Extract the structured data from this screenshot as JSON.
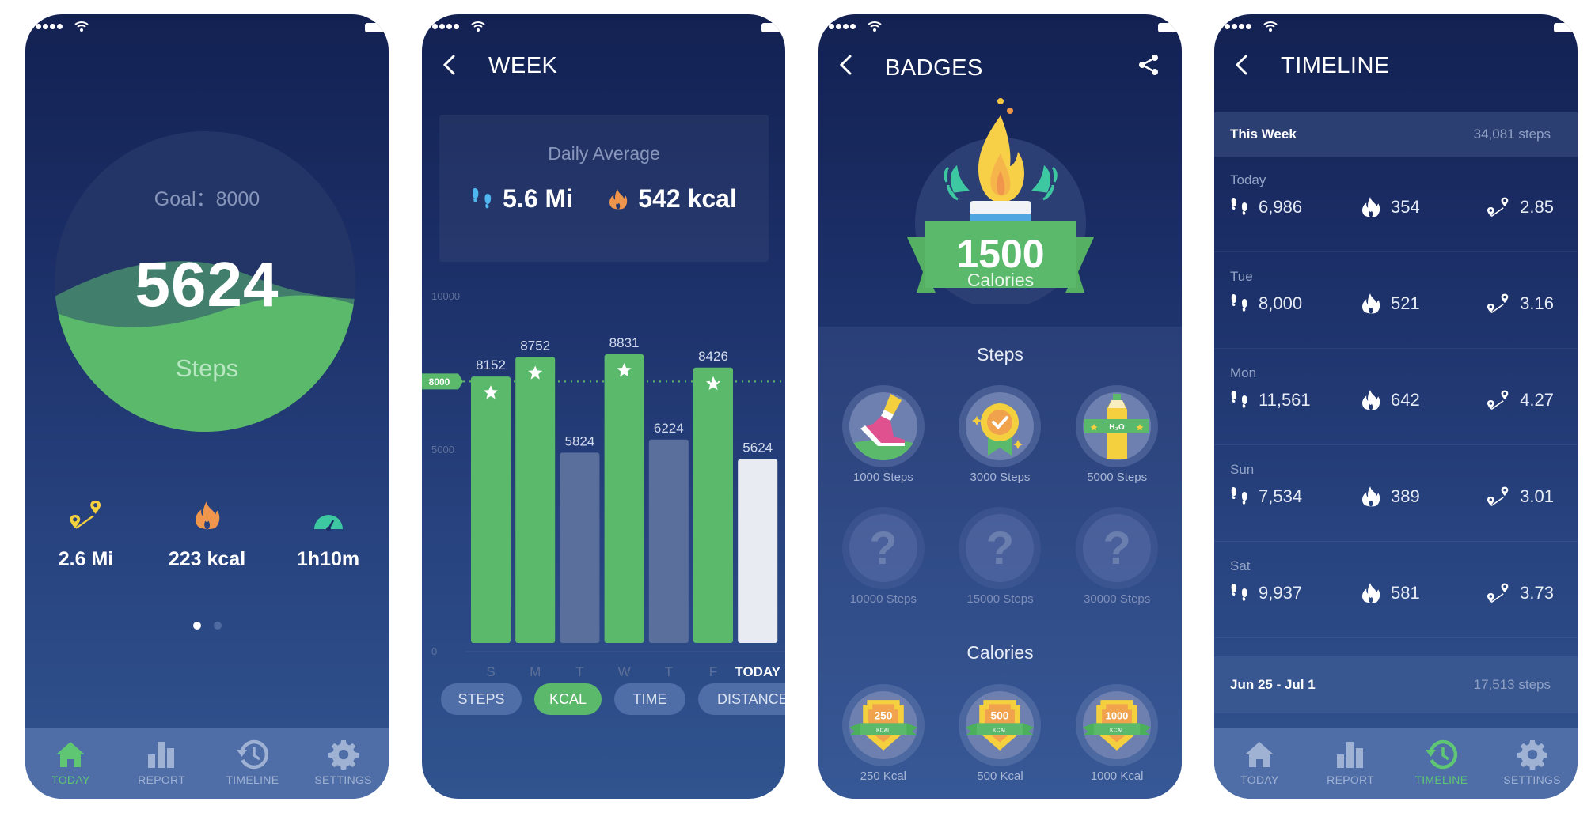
{
  "colors": {
    "green": "#5bb96b",
    "active_tab": "#5fc774",
    "bg_top": "#132152",
    "bg_bottom": "#30548f",
    "tabbar": "#4f6da6",
    "yellow": "#f4d03f",
    "orange": "#f0964c",
    "teal": "#3ec8a2"
  },
  "tabbar": {
    "items": [
      {
        "label": "TODAY",
        "icon": "home-icon"
      },
      {
        "label": "REPORT",
        "icon": "bar-chart-icon"
      },
      {
        "label": "TIMELINE",
        "icon": "history-icon"
      },
      {
        "label": "SETTINGS",
        "icon": "gear-icon"
      }
    ]
  },
  "today": {
    "goal_label": "Goal：8000",
    "steps": "5624",
    "steps_label": "Steps",
    "progress_fraction": 0.703,
    "stats": [
      {
        "icon": "route-pin-icon",
        "value": "2.6 Mi"
      },
      {
        "icon": "flame-icon",
        "value": "223 kcal"
      },
      {
        "icon": "speedometer-icon",
        "value": "1h10m"
      }
    ],
    "page_dots": {
      "count": 2,
      "active": 0
    },
    "active_tab": 0
  },
  "week": {
    "title": "WEEK",
    "daily_average_label": "Daily Average",
    "avg_distance": "5.6 Mi",
    "avg_kcal": "542 kcal",
    "pills": [
      {
        "label": "STEPS",
        "active": false
      },
      {
        "label": "KCAL",
        "active": true
      },
      {
        "label": "TIME",
        "active": false
      },
      {
        "label": "DISTANCE",
        "active": false
      }
    ]
  },
  "chart_data": {
    "type": "bar",
    "title": "",
    "xlabel": "",
    "ylabel": "",
    "categories": [
      "S",
      "M",
      "T",
      "W",
      "T",
      "F",
      "TODAY"
    ],
    "values": [
      8152,
      8752,
      5824,
      8831,
      6224,
      8426,
      5624
    ],
    "goal": 8000,
    "goal_label": "8000",
    "y_ticks": [
      0,
      5000,
      10000
    ],
    "y_tick_labels": [
      "0",
      "5000",
      "10000"
    ],
    "ylim": [
      0,
      10000
    ],
    "grid": false,
    "goal_met_marker": "star",
    "bar_colors": {
      "met": "#5bb96b",
      "unmet": "#5a6f9c",
      "today": "#e8ebf2"
    }
  },
  "badges": {
    "title": "BADGES",
    "hero_value": "1500",
    "hero_unit": "Calories",
    "steps_section": "Steps",
    "steps_badges": [
      {
        "label": "1000 Steps",
        "unlocked": true,
        "icon": "sneaker-icon"
      },
      {
        "label": "3000 Steps",
        "unlocked": true,
        "icon": "medal-check-icon"
      },
      {
        "label": "5000 Steps",
        "unlocked": true,
        "icon": "water-bottle-icon",
        "bottle_text": "H₂O"
      },
      {
        "label": "10000 Steps",
        "unlocked": false,
        "icon": "question-icon",
        "glyph": "?"
      },
      {
        "label": "15000 Steps",
        "unlocked": false,
        "icon": "question-icon",
        "glyph": "?"
      },
      {
        "label": "30000 Steps",
        "unlocked": false,
        "icon": "question-icon",
        "glyph": "?"
      }
    ],
    "calories_section": "Calories",
    "calories_badges": [
      {
        "label": "250 Kcal",
        "value": "250",
        "unit": "KCAL"
      },
      {
        "label": "500 Kcal",
        "value": "500",
        "unit": "KCAL"
      },
      {
        "label": "1000 Kcal",
        "value": "1000",
        "unit": "KCAL"
      }
    ]
  },
  "timeline": {
    "title": "TIMELINE",
    "this_week": {
      "label": "This Week",
      "total": "34,081 steps"
    },
    "days": [
      {
        "day": "Today",
        "steps": "6,986",
        "kcal": "354",
        "distance": "2.85"
      },
      {
        "day": "Tue",
        "steps": "8,000",
        "kcal": "521",
        "distance": "3.16"
      },
      {
        "day": "Mon",
        "steps": "11,561",
        "kcal": "642",
        "distance": "4.27"
      },
      {
        "day": "Sun",
        "steps": "7,534",
        "kcal": "389",
        "distance": "3.01"
      },
      {
        "day": "Sat",
        "steps": "9,937",
        "kcal": "581",
        "distance": "3.73"
      }
    ],
    "prev_week": {
      "label": "Jun 25 - Jul 1",
      "total": "17,513 steps"
    },
    "active_tab": 2
  }
}
